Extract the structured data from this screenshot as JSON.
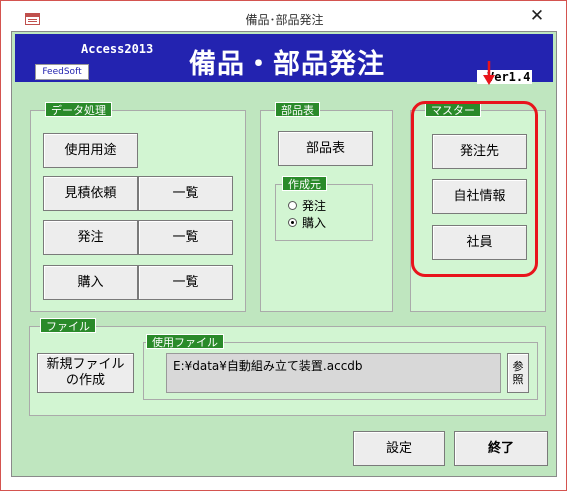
{
  "window": {
    "title": "備品･部品発注",
    "close_glyph": "✕"
  },
  "header": {
    "app_name": "Access2013",
    "logo_text": "FeedSoft",
    "title": "備品・部品発注",
    "version": "Ver1.4"
  },
  "data_group": {
    "label": "データ処理",
    "usage_button": "使用用途",
    "quote_button": "見積依頼",
    "quote_list_button": "一覧",
    "order_button": "発注",
    "order_list_button": "一覧",
    "purchase_button": "購入",
    "purchase_list_button": "一覧"
  },
  "parts_group": {
    "label": "部品表",
    "parts_button": "部品表",
    "sub_label": "作成元",
    "options": [
      "発注",
      "購入"
    ],
    "selected": "購入"
  },
  "master_group": {
    "label": "マスター",
    "supplier_button": "発注先",
    "company_button": "自社情報",
    "staff_button": "社員"
  },
  "file_group": {
    "label": "ファイル",
    "new_file_line1": "新規ファイル",
    "new_file_line2": "の作成",
    "used_label": "使用ファイル",
    "path_value": "E:¥data¥自動組み立て装置.accdb",
    "browse_line1": "参",
    "browse_line2": "照"
  },
  "footer": {
    "settings_button": "設定",
    "exit_button": "終了"
  },
  "colors": {
    "header_bg": "#2323b0",
    "form_bg": "#bfe6bf",
    "group_label_bg": "#2a8a2a",
    "highlight": "#e8141c"
  },
  "icons": [
    "app-icon",
    "close-icon",
    "down-arrow-icon"
  ]
}
